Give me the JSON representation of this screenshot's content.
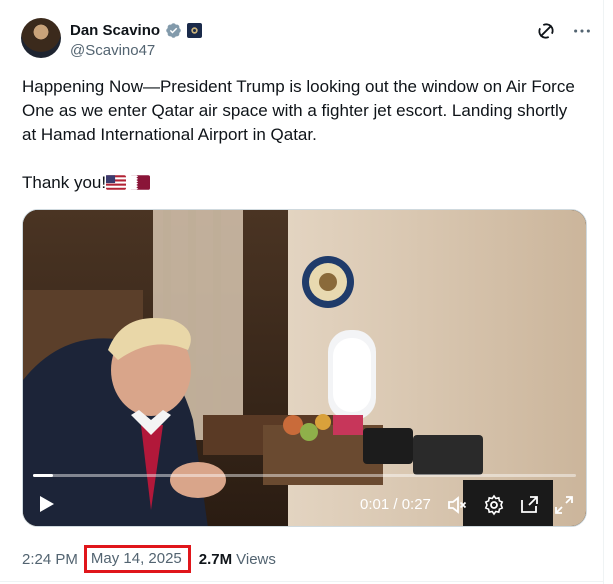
{
  "author": {
    "display_name": "Dan Scavino",
    "handle": "@Scavino47",
    "verified": true
  },
  "tweet": {
    "text": "Happening Now—President Trump is looking out the window on Air Force One as we enter Qatar air space with a fighter jet escort. Landing shortly at Hamad International Airport in Qatar.",
    "thanks": "Thank you!",
    "flags": [
      "us-flag-icon",
      "qatar-flag-icon"
    ]
  },
  "video": {
    "current_time": "0:01",
    "duration": "0:27",
    "time_display": "0:01 / 0:27",
    "progress_fraction": 0.037,
    "muted": true
  },
  "meta": {
    "time": "2:24 PM",
    "separator": "·",
    "date": "May 14, 2025",
    "views_count": "2.7M",
    "views_label": "Views"
  },
  "colors": {
    "text": "#0f1419",
    "secondary": "#536471",
    "verified_blue": "#1d9bf0",
    "highlight_red": "#e0161b"
  }
}
